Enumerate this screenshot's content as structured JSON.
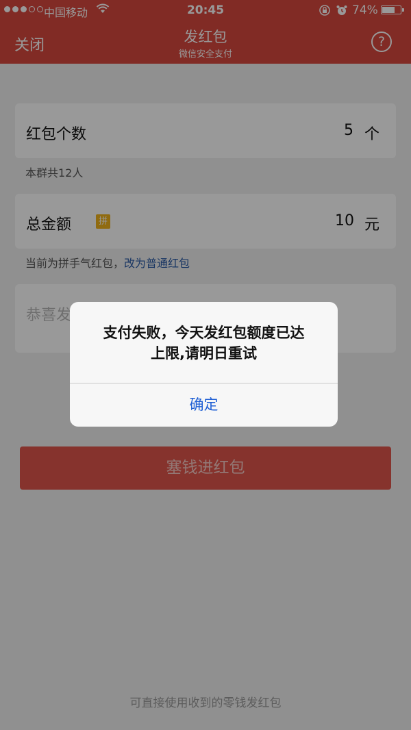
{
  "status_bar": {
    "carrier": "中国移动",
    "time": "20:45",
    "battery_percent": "74%",
    "battery_level": 0.74,
    "signal_dots_filled": 3,
    "signal_dots_total": 5,
    "icons": [
      "wifi-icon",
      "orientation-lock-icon",
      "alarm-icon",
      "battery-icon"
    ]
  },
  "nav": {
    "close_label": "关闭",
    "title": "发红包",
    "subtitle": "微信安全支付",
    "help_symbol": "?"
  },
  "form": {
    "count": {
      "label": "红包个数",
      "value": "5",
      "unit": "个"
    },
    "count_hint": "本群共12人",
    "amount": {
      "label": "总金额",
      "badge": "拼",
      "value": "10",
      "unit": "元"
    },
    "amount_hint": "当前为拼手气红包，",
    "switch_link": "改为普通红包",
    "greeting_placeholder": "恭喜发"
  },
  "submit_label": "塞钱进红包",
  "footer_note": "可直接使用收到的零钱发红包",
  "alert": {
    "message_line1": "支付失败，今天发红包额度已达",
    "message_line2": "上限,请明日重试",
    "ok_label": "确定"
  },
  "colors": {
    "brand_red": "#d8483e",
    "badge_yellow": "#f0b21b",
    "link_blue": "#2a5aa6",
    "ok_blue": "#1f5fd4"
  }
}
